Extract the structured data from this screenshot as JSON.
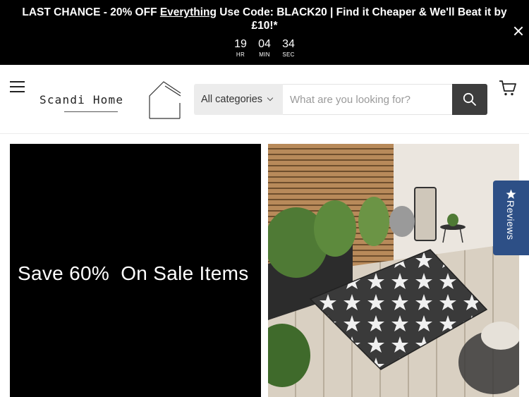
{
  "announcement": {
    "part1": "LAST CHANCE - 20% OFF ",
    "link": "Everything",
    "part2": " Use Code: BLACK20 | Find it Cheaper & We'll Beat it by £10!*",
    "countdown": [
      {
        "value": "19",
        "label": "HR"
      },
      {
        "value": "04",
        "label": "MIN"
      },
      {
        "value": "34",
        "label": "SEC"
      }
    ]
  },
  "header": {
    "logo_text": "Scandi Home",
    "category_label": "All categories",
    "search_placeholder": "What are you looking for?"
  },
  "hero": {
    "promo_text": "Save 60%  On Sale Items"
  },
  "reviews_tab": {
    "label": "Reviews"
  },
  "colors": {
    "announcement_bg": "#000000",
    "search_button": "#3d3d3d",
    "reviews_tab": "#2d4f86"
  }
}
